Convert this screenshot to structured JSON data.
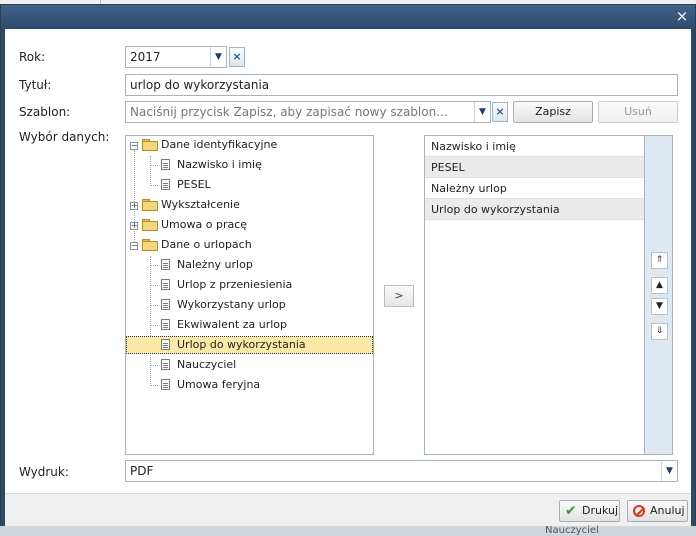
{
  "labels": {
    "year": "Rok:",
    "title": "Tytuł:",
    "template": "Szablon:",
    "data_selection": "Wybór danych:",
    "print": "Wydruk:"
  },
  "fields": {
    "year_value": "2017",
    "title_value": "urlop do wykorzystania",
    "template_placeholder": "Naciśnij przycisk Zapisz, aby zapisać nowy szablon...",
    "print_value": "PDF"
  },
  "buttons": {
    "save": "Zapisz",
    "remove": "Usuń",
    "move_right": ">",
    "print": "Drukuj",
    "cancel": "Anuluj",
    "close": "×",
    "clear": "×"
  },
  "tree": [
    {
      "label": "Dane identyfikacyjne",
      "type": "folder",
      "expanded": true
    },
    {
      "label": "Nazwisko i imię",
      "type": "leaf"
    },
    {
      "label": "PESEL",
      "type": "leaf"
    },
    {
      "label": "Wykształcenie",
      "type": "folder",
      "expanded": false
    },
    {
      "label": "Umowa o pracę",
      "type": "folder",
      "expanded": false
    },
    {
      "label": "Dane o urlopach",
      "type": "folder",
      "expanded": true
    },
    {
      "label": "Należny urlop",
      "type": "leaf"
    },
    {
      "label": "Urlop z przeniesienia",
      "type": "leaf"
    },
    {
      "label": "Wykorzystany urlop",
      "type": "leaf"
    },
    {
      "label": "Ekwiwalent za urlop",
      "type": "leaf"
    },
    {
      "label": "Urlop do wykorzystania",
      "type": "leaf",
      "selected": true
    },
    {
      "label": "Nauczyciel",
      "type": "leaf"
    },
    {
      "label": "Umowa feryjna",
      "type": "leaf"
    }
  ],
  "selected_list": [
    "Nazwisko i imię",
    "PESEL",
    "Należny urlop",
    "Urlop do wykorzystania"
  ],
  "background": {
    "ghost_text": "Nauczyciel"
  },
  "colors": {
    "titlebar": "#2f4a66",
    "selection": "#fde9a6",
    "rail": "#dde8f2"
  }
}
